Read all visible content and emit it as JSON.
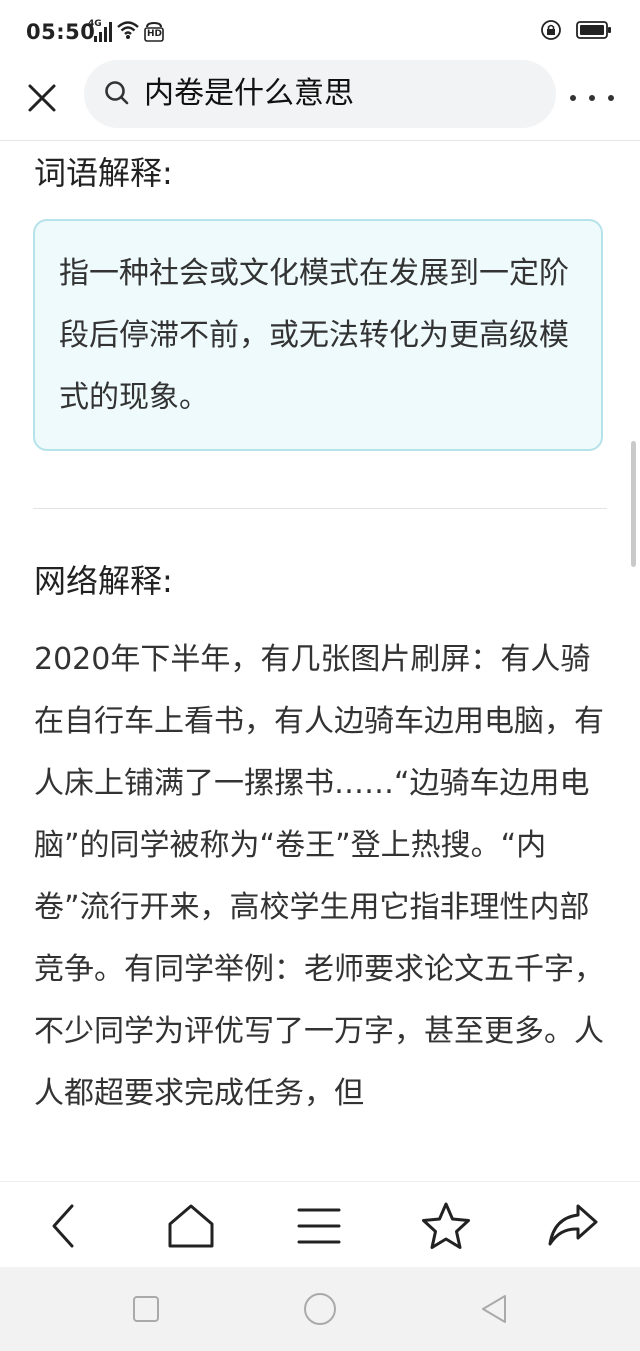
{
  "status_bar": {
    "time": "05:50",
    "network_label": "4G",
    "hd_label": "HD"
  },
  "toolbar": {
    "search_query": "内卷是什么意思",
    "icons": [
      "close-icon",
      "search-icon",
      "more-icon"
    ]
  },
  "content": {
    "section1_title": "词语解释:",
    "definition": "指一种社会或文化模式在发展到一定阶段后停滞不前，或无法转化为更高级模式的现象。",
    "section2_title": "网络解释:",
    "paragraph": "2020年下半年，有几张图片刷屏：有人骑在自行车上看书，有人边骑车边用电脑，有人床上铺满了一摞摞书……“边骑车边用电脑”的同学被称为“卷王”登上热搜。“内卷”流行开来，高校学生用它指非理性内部竞争。有同学举例：老师要求论文五千字，不少同学为评优写了一万字，甚至更多。人人都超要求完成任务，但"
  },
  "bottom_nav": {
    "icons": [
      "back-icon",
      "home-icon",
      "menu-icon",
      "star-icon",
      "share-icon"
    ]
  },
  "system_nav": {
    "icons": [
      "recent-apps-icon",
      "home-circle-icon",
      "back-triangle-icon"
    ]
  },
  "colors": {
    "card_bg": "#eefafb",
    "card_border": "#b6e3ea",
    "search_bg": "#f2f3f5",
    "text": "#333333"
  }
}
